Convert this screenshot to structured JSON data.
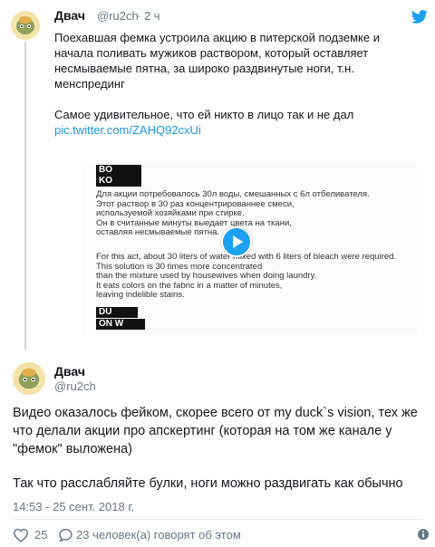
{
  "quoted": {
    "name": "Двач",
    "handle": "@ru2ch",
    "time": "· 2 ч",
    "text_p1": "Поехавшая фемка устроила акцию в питерской подземке и начала поливать мужиков раствором, который оставляет несмываемые пятна, за широко раздвинутые ноги, т.н. менспрединг",
    "text_p2": "Самое удивительное, что ей никто в лицо так и не дал",
    "link": "pic.twitter.com/ZAHQ92cxUi",
    "media": {
      "redacted_1": "BO",
      "redacted_2": "KO",
      "ru_lines": [
        "Для акции потребовалось 30л воды, смешанных с 6л отбеливателя.",
        "Этот раствор в 30 раз концентрированнее смеси,",
        "используемой хозяйками при стирке.",
        "Он в считанные минуты выедает цвета на ткани,",
        "оставляя несмываемые пятна."
      ],
      "en_lines": [
        "For this act, about 30 liters of water mixed with 6 liters of bleach were required.",
        "This solution is 30 times more concentrated",
        "than the mixture used by housewives when doing laundry.",
        "It eats colors on the fabric in a matter of minutes,",
        "leaving indelible stains."
      ],
      "redacted_3": "DU",
      "redacted_4": "ON W"
    }
  },
  "main": {
    "name": "Двач",
    "handle": "@ru2ch",
    "text_p1": "Видео оказалось фейком, скорее всего от my duck`s vision, тех же что делали акции про апскертинг (которая на том же канале у \"фемок\" выложена)",
    "text_p2": "Так что расслабляйте булки, ноги можно раздвигать как обычно",
    "datetime": "14:53 - 25 сент. 2018 г.",
    "likes": "25",
    "people_text": "23 человек(а) говорят об этом"
  },
  "colors": {
    "accent": "#1da1f2",
    "link": "#1b95e0",
    "muted": "#657786"
  }
}
